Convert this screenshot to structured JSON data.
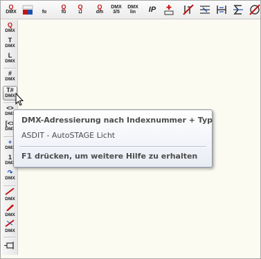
{
  "toolbar": {
    "buttons": [
      {
        "top": "Q",
        "label": "DMX"
      },
      {
        "top": "",
        "label": ""
      },
      {
        "top": "",
        "label": "fo"
      },
      {
        "top": "Q",
        "label": "fu"
      },
      {
        "top": "Q",
        "label": ""
      },
      {
        "top": "Q",
        "label": "dm"
      },
      {
        "top": "DMX",
        "label": "3/5"
      },
      {
        "top": "DMX",
        "label": "lin"
      },
      {
        "top": "",
        "label": "IP"
      },
      {
        "top": "",
        "label": ""
      },
      {
        "top": "",
        "label": ""
      },
      {
        "top": "",
        "label": ""
      },
      {
        "top": "",
        "label": ""
      },
      {
        "top": "",
        "label": ""
      },
      {
        "top": "",
        "label": ""
      }
    ]
  },
  "vbar": {
    "buttons": [
      {
        "g": "Q",
        "label": "DMX",
        "color": "red"
      },
      {
        "g": "T",
        "label": "DMX",
        "color": "dark"
      },
      {
        "g": "L",
        "label": "DMX",
        "color": "dark"
      },
      {
        "g": "#",
        "label": "DMX",
        "color": "dark"
      },
      {
        "g": "T#",
        "label": "DMX",
        "color": "dark"
      },
      {
        "g": "<>",
        "label": "DMX",
        "color": "dark"
      },
      {
        "g": "[<>",
        "label": "DMX",
        "color": "dark"
      },
      {
        "g": "+",
        "label": "DMX",
        "color": "blue"
      },
      {
        "g": "1",
        "label": "DMX",
        "color": "dark"
      },
      {
        "g": "↷",
        "label": "DMX",
        "color": "blue"
      },
      {
        "g": "",
        "label": "DMX",
        "color": "red"
      },
      {
        "g": "",
        "label": "DMX",
        "color": "red"
      },
      {
        "g": "",
        "label": "DMX",
        "color": "red"
      }
    ]
  },
  "tooltip": {
    "title": "DMX-Adressierung nach Indexnummer + Typ",
    "subtitle": "ASDIT - AutoSTAGE Licht",
    "help": "F1 drücken, um weitere Hilfe zu erhalten"
  },
  "colors": {
    "accent_red": "#c41414",
    "accent_blue": "#1f4fb0",
    "canvas": "#fcfbf2"
  }
}
